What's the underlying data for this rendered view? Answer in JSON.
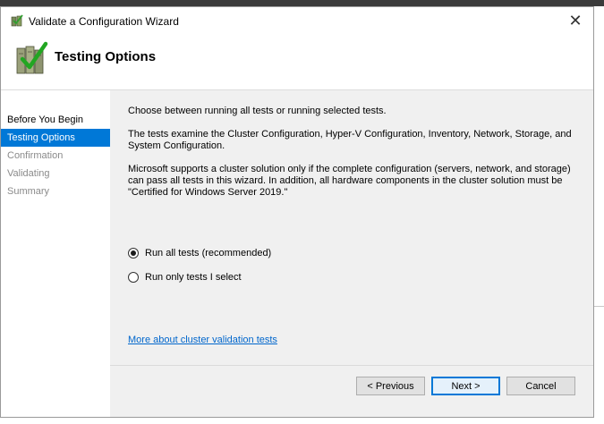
{
  "window": {
    "title": "Validate a Configuration Wizard",
    "close_glyph": "✕"
  },
  "header": {
    "title": "Testing Options",
    "icon": "cluster-validate-icon"
  },
  "nav": {
    "items": [
      {
        "label": "Before You Begin",
        "state": "done"
      },
      {
        "label": "Testing Options",
        "state": "active"
      },
      {
        "label": "Confirmation",
        "state": "pending"
      },
      {
        "label": "Validating",
        "state": "pending"
      },
      {
        "label": "Summary",
        "state": "pending"
      }
    ]
  },
  "content": {
    "intro": "Choose between running all tests or running selected tests.",
    "para1": "The tests examine the Cluster Configuration, Hyper-V Configuration, Inventory, Network, Storage, and System Configuration.",
    "para2": "Microsoft supports a cluster solution only if the complete configuration (servers, network, and storage) can pass all tests in this wizard. In addition, all hardware components in the cluster solution must be \"Certified for Windows Server 2019.\"",
    "options": [
      {
        "label": "Run all tests (recommended)",
        "selected": true
      },
      {
        "label": "Run only tests I select",
        "selected": false
      }
    ],
    "link": "More about cluster validation tests"
  },
  "buttons": {
    "previous": "< Previous",
    "next": "Next >",
    "cancel": "Cancel"
  },
  "colors": {
    "accent": "#0078d7",
    "link": "#0066cc",
    "content_bg": "#f0f0f0"
  }
}
